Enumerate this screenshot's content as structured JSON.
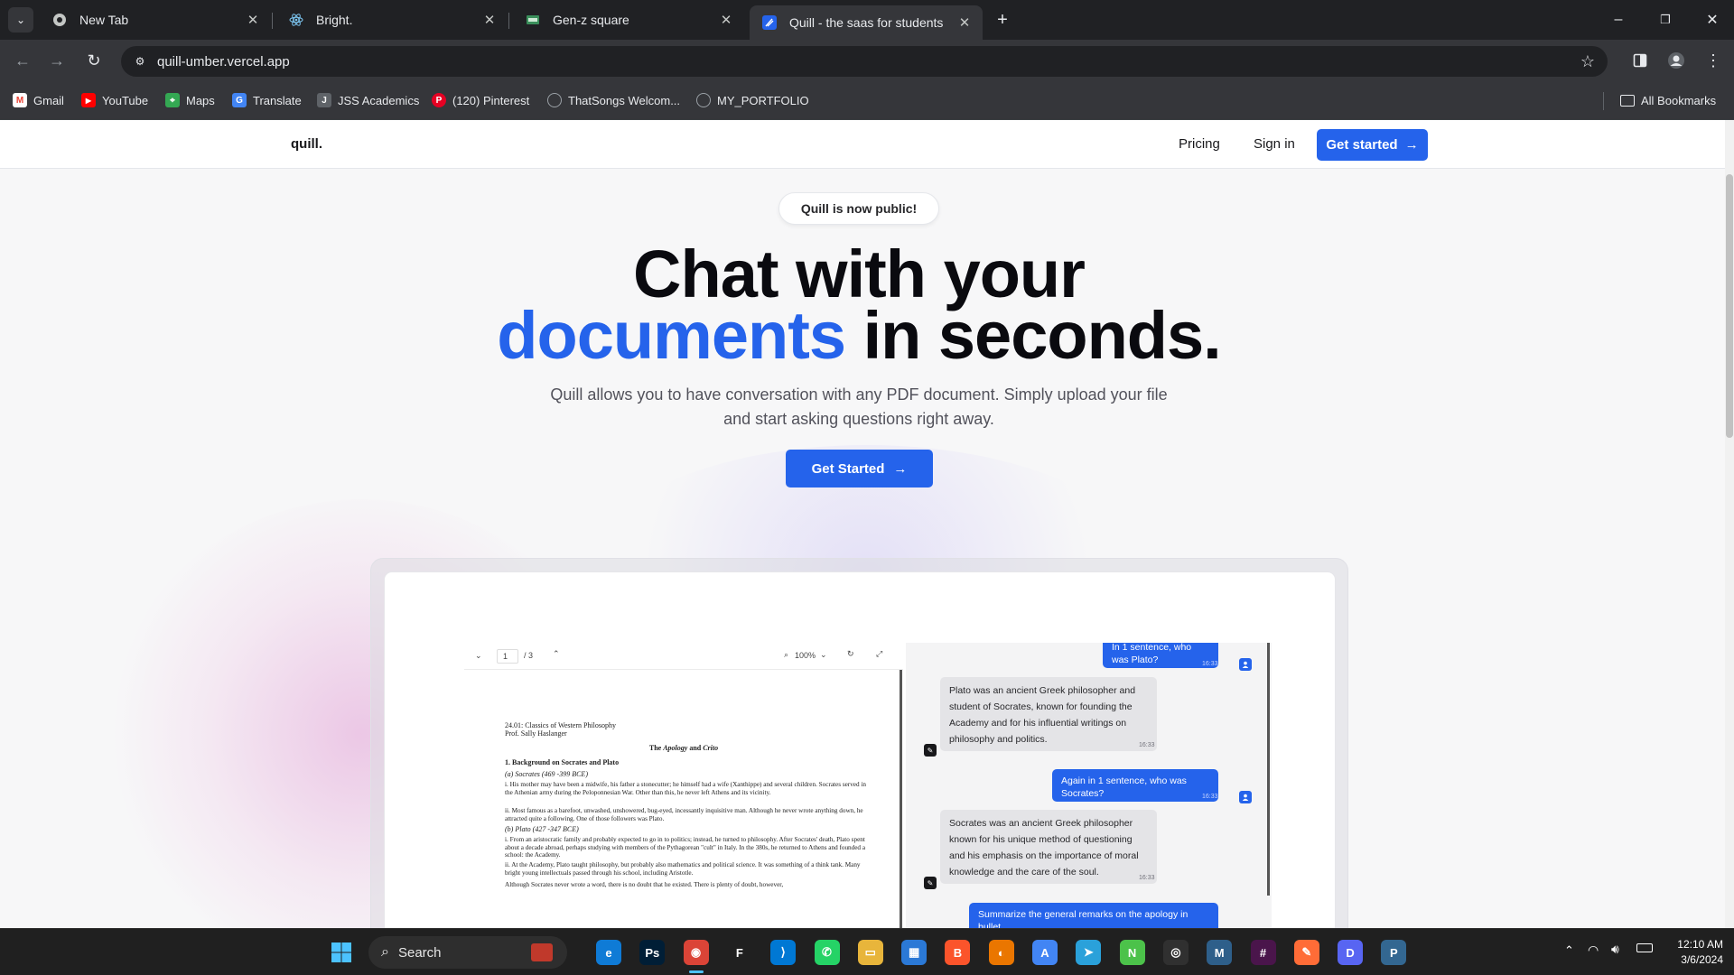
{
  "browser": {
    "tabs": [
      {
        "label": "New Tab",
        "icon": "chrome-icon"
      },
      {
        "label": "Bright.",
        "icon": "react-icon"
      },
      {
        "label": "Gen-z square",
        "icon": "genz-icon"
      },
      {
        "label": "Quill - the saas for students",
        "icon": "quill-icon",
        "active": true
      }
    ],
    "url": "quill-umber.vercel.app",
    "bookmarks": [
      {
        "label": "Gmail",
        "color": "#ea4335"
      },
      {
        "label": "YouTube",
        "color": "#ff0000"
      },
      {
        "label": "Maps",
        "color": "#34a853"
      },
      {
        "label": "Translate",
        "color": "#4285f4"
      },
      {
        "label": "JSS Academics",
        "color": "#5f6368"
      },
      {
        "label": "(120) Pinterest",
        "color": "#e60023"
      },
      {
        "label": "ThatSongs Welcom...",
        "color": "#9aa0a6"
      },
      {
        "label": "MY_PORTFOLIO",
        "color": "#9aa0a6"
      }
    ],
    "all_bookmarks": "All Bookmarks"
  },
  "site": {
    "logo": "quill.",
    "nav": {
      "pricing": "Pricing",
      "signin": "Sign in",
      "cta": "Get started"
    },
    "pill": "Quill is now public!",
    "headline_1": "Chat with your",
    "headline_2_accent": "documents",
    "headline_2_rest": " in seconds.",
    "subtitle": "Quill allows you to have conversation with any PDF document. Simply upload your file and start asking questions right away.",
    "cta": "Get Started",
    "accent_color": "#2563eb"
  },
  "preview": {
    "pdf": {
      "page_current": "1",
      "page_total": "/ 3",
      "zoom": "100%",
      "header_line1": "24.01: Classics of Western Philosophy",
      "header_line2": "Prof. Sally Haslanger",
      "title_a": "The ",
      "title_b": "Apology",
      "title_c": " and ",
      "title_d": "Crito",
      "section": "1.  Background on Socrates and Plato",
      "sub_a": "(a) Socrates (469 -399 BCE)",
      "para_1": "i. His mother may have been a midwife, his father a stonecutter; he himself had a wife (Xanthippe) and several children. Socrates served in the Athenian army during the Peloponnesian War. Other than this, he never left Athens and its vicinity.",
      "para_2": "ii. Most famous as a barefoot, unwashed, unshowered, bug-eyed, incessantly inquisitive man. Although he never wrote anything down, he attracted quite a following. One of those followers was Plato.",
      "sub_b": "(b) Plato (427 -347 BCE)",
      "para_3": "i. From an aristocratic family and probably expected to go in to politics; instead, he turned to philosophy. After Socrates' death, Plato spent about a decade abroad, perhaps studying with members of the Pythagorean \"cult\" in Italy. In the 380s, he returned to Athens and founded a school: the Academy.",
      "para_4": "ii. At the Academy, Plato taught philosophy, but probably also mathematics and political science. It was something of a think tank. Many bright young intellectuals passed through his school, including Aristotle.",
      "para_5": "Although Socrates never wrote a word, there is no doubt that he existed. There is plenty of doubt, however,"
    },
    "chat": {
      "m1": "In 1 sentence, who was Plato?",
      "t1": "16:33",
      "a1": "Plato was an ancient Greek philosopher and student of Socrates, known for founding the Academy and for his influential writings on philosophy and politics.",
      "ta1": "16:33",
      "m2": "Again in 1 sentence, who was Socrates?",
      "t2": "16:33",
      "a2": "Socrates was an ancient Greek philosopher known for his unique method of questioning and his emphasis on the importance of moral knowledge and the care of the soul.",
      "ta2": "16:33",
      "m3": "Summarize the general remarks on the apology in bullet"
    }
  },
  "taskbar": {
    "search": "Search",
    "time": "12:10 AM",
    "date": "3/6/2024",
    "apps": [
      {
        "name": "edge-icon",
        "color": "#0f7bd6",
        "glyph": "e"
      },
      {
        "name": "photoshop-icon",
        "color": "#001e36",
        "glyph": "Ps"
      },
      {
        "name": "chrome-icon",
        "color": "#db4437",
        "glyph": "◉"
      },
      {
        "name": "figma-icon",
        "color": "#202020",
        "glyph": "F"
      },
      {
        "name": "vscode-icon",
        "color": "#0078d4",
        "glyph": "⟩"
      },
      {
        "name": "whatsapp-icon",
        "color": "#25d366",
        "glyph": "✆"
      },
      {
        "name": "file-explorer-icon",
        "color": "#e8b53b",
        "glyph": "▭"
      },
      {
        "name": "store-icon",
        "color": "#2b79d6",
        "glyph": "▦"
      },
      {
        "name": "brave-icon",
        "color": "#fb542b",
        "glyph": "B"
      },
      {
        "name": "blender-icon",
        "color": "#ea7600",
        "glyph": "◐"
      },
      {
        "name": "android-studio-icon",
        "color": "#4285f4",
        "glyph": "A"
      },
      {
        "name": "telegram-icon",
        "color": "#2aa1da",
        "glyph": "➤"
      },
      {
        "name": "notepad-icon",
        "color": "#4cc24a",
        "glyph": "N"
      },
      {
        "name": "obs-icon",
        "color": "#303030",
        "glyph": "◎"
      },
      {
        "name": "mysql-icon",
        "color": "#2e5f8a",
        "glyph": "M"
      },
      {
        "name": "slack-icon",
        "color": "#4a154b",
        "glyph": "#"
      },
      {
        "name": "postman-icon",
        "color": "#ff6c37",
        "glyph": "✎"
      },
      {
        "name": "discord-icon",
        "color": "#5865f2",
        "glyph": "D"
      },
      {
        "name": "postgres-icon",
        "color": "#336791",
        "glyph": "P"
      }
    ]
  }
}
